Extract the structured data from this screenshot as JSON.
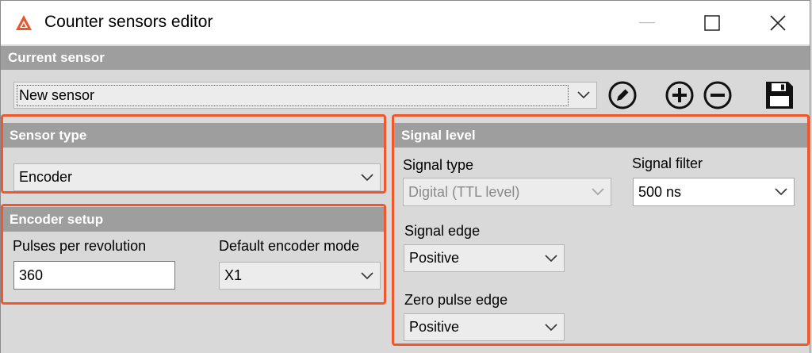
{
  "window": {
    "title": "Counter sensors editor"
  },
  "current_sensor": {
    "header": "Current sensor",
    "selected": "New sensor"
  },
  "toolbar": {
    "icons": [
      "edit-icon",
      "add-icon",
      "remove-icon",
      "save-icon"
    ]
  },
  "sensor_type": {
    "header": "Sensor type",
    "selected": "Encoder"
  },
  "encoder_setup": {
    "header": "Encoder setup",
    "pulses_label": "Pulses per revolution",
    "pulses_value": "360",
    "mode_label": "Default encoder mode",
    "mode_selected": "X1"
  },
  "signal_level": {
    "header": "Signal level",
    "signal_type_label": "Signal type",
    "signal_type_selected": "Digital (TTL level)",
    "signal_filter_label": "Signal filter",
    "signal_filter_selected": "500 ns",
    "signal_edge_label": "Signal edge",
    "signal_edge_selected": "Positive",
    "zero_pulse_label": "Zero pulse edge",
    "zero_pulse_selected": "Positive"
  },
  "colors": {
    "highlight": "#f0572a",
    "header_bg": "#9e9e9e",
    "panel_bg": "#d9d9d9"
  }
}
